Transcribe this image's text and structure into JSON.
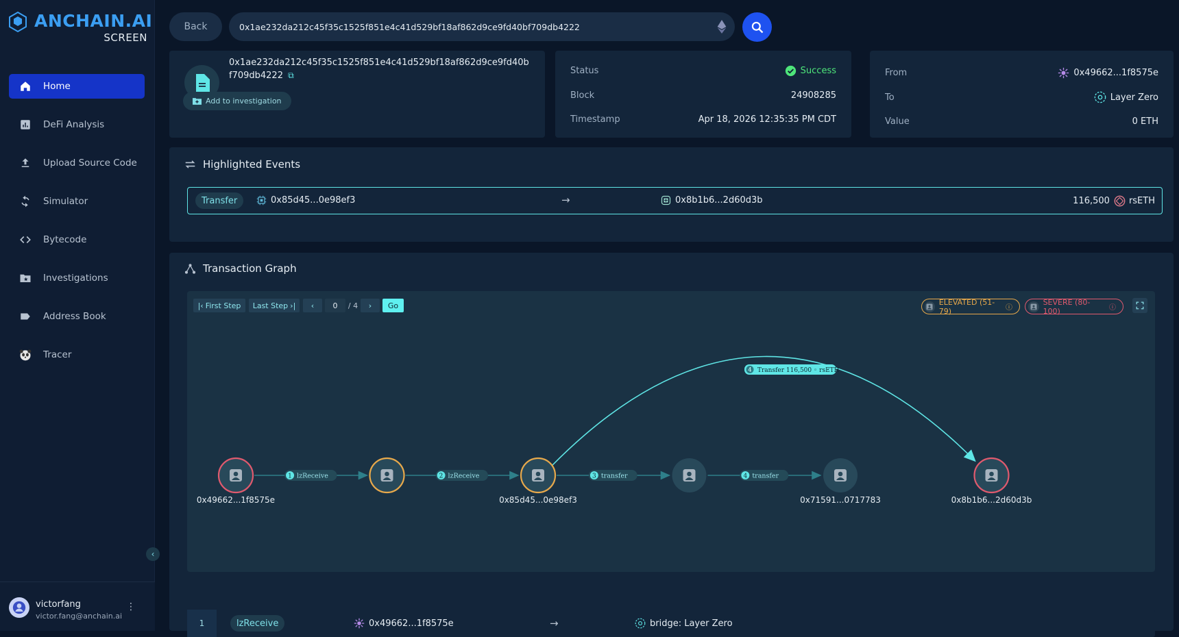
{
  "brand": {
    "name": "ANCHAIN.AI",
    "product": "SCREEN"
  },
  "sidebar": {
    "items": [
      {
        "label": "Home",
        "icon": "home-icon",
        "active": true
      },
      {
        "label": "DeFi Analysis",
        "icon": "chart-icon"
      },
      {
        "label": "Upload Source Code",
        "icon": "upload-icon"
      },
      {
        "label": "Simulator",
        "icon": "refresh-icon"
      },
      {
        "label": "Bytecode",
        "icon": "code-icon"
      },
      {
        "label": "Investigations",
        "icon": "folder-star-icon"
      },
      {
        "label": "Address Book",
        "icon": "label-icon"
      },
      {
        "label": "Tracer",
        "icon": "panda-icon"
      }
    ]
  },
  "user": {
    "name": "victorfang",
    "email": "victor.fang@anchain.ai"
  },
  "topbar": {
    "back_label": "Back",
    "search_value": "0x1ae232da212c45f35c1525f851e4c41d529bf18af862d9ce9fd40bf709db4222"
  },
  "tx": {
    "hash": "0x1ae232da212c45f35c1525f851e4c41d529bf18af862d9ce9fd40bf709db4222",
    "add_label": "Add to investigation"
  },
  "status_card": {
    "status_label": "Status",
    "status_value": "Success",
    "block_label": "Block",
    "block_value": "24908285",
    "timestamp_label": "Timestamp",
    "timestamp_value": "Apr 18, 2026 12:35:35 PM CDT"
  },
  "flow_card": {
    "from_label": "From",
    "from_value": "0x49662...1f8575e",
    "to_label": "To",
    "to_value": "Layer Zero",
    "value_label": "Value",
    "value_value": "0 ETH"
  },
  "events": {
    "title": "Highlighted Events",
    "rows": [
      {
        "type": "Transfer",
        "from": "0x85d45...0e98ef3",
        "to": "0x8b1b6...2d60d3b",
        "amount": "116,500",
        "token": "rsETH"
      }
    ]
  },
  "graph": {
    "title": "Transaction Graph",
    "controls": {
      "first": "First Step",
      "last": "Last Step",
      "step": "0",
      "total": "/ 4",
      "go": "Go"
    },
    "risk": {
      "elevated": "ELEVATED (51-79)",
      "severe": "SEVERE (80-100)"
    },
    "nodes": [
      {
        "label": "0x49662...1f8575e",
        "risk": "severe"
      },
      {
        "label": "",
        "risk": "elevated"
      },
      {
        "label": "0x85d45...0e98ef3",
        "risk": "elevated"
      },
      {
        "label": "",
        "risk": "none"
      },
      {
        "label": "0x71591...0717783",
        "risk": "none"
      },
      {
        "label": "0x8b1b6...2d60d3b",
        "risk": "severe"
      }
    ],
    "edges": [
      {
        "num": "1",
        "label": "lzReceive"
      },
      {
        "num": "2",
        "label": "lzReceive"
      },
      {
        "num": "3",
        "label": "transfer"
      },
      {
        "num": "4",
        "label": "transfer"
      }
    ],
    "highlight_edge": {
      "num": "4",
      "label": "Transfer",
      "amount": "116,500",
      "token": "rsETH"
    }
  },
  "calls": {
    "rows": [
      {
        "index": "1",
        "method": "lzReceive",
        "from": "0x49662...1f8575e",
        "to": "bridge: Layer Zero"
      }
    ]
  },
  "colors": {
    "accent": "#1534c8",
    "teal": "#5fe6e6",
    "severe": "#e05a6e",
    "elevated": "#e8a94b"
  }
}
